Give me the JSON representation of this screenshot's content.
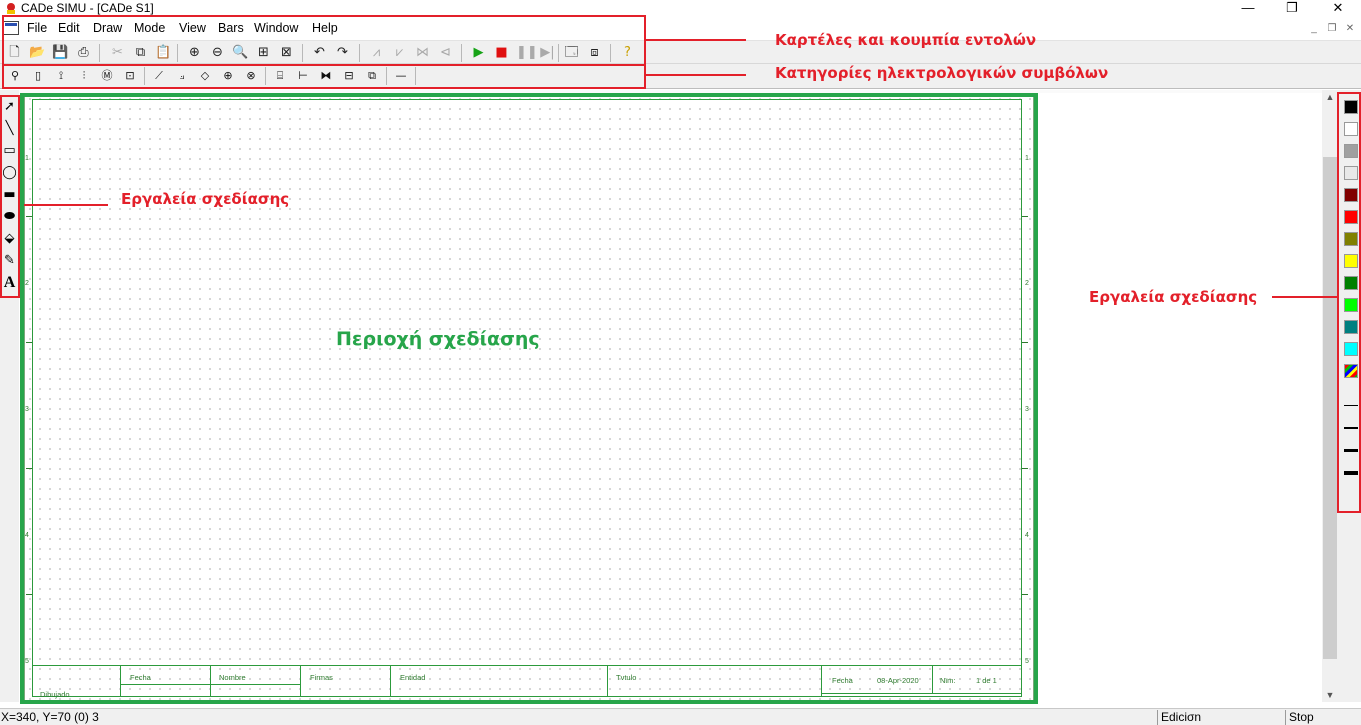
{
  "window": {
    "title": "CADe SIMU - [CADe S1]",
    "minimize": "—",
    "maximize": "❐",
    "close": "✕"
  },
  "menu": {
    "items": [
      "File",
      "Edit",
      "Draw",
      "Mode",
      "View",
      "Bars",
      "Window",
      "Help"
    ],
    "mdi_min": "_",
    "mdi_restore": "❐",
    "mdi_close": "✕"
  },
  "toolbar1": {
    "icons": [
      {
        "name": "new-file-icon",
        "glyph": "🗋",
        "enabled": true
      },
      {
        "name": "open-folder-icon",
        "glyph": "📂",
        "enabled": true
      },
      {
        "name": "save-icon",
        "glyph": "💾",
        "enabled": true
      },
      {
        "name": "print-icon",
        "glyph": "⎙",
        "enabled": true
      },
      {
        "name": "cut-icon",
        "glyph": "✂",
        "enabled": false
      },
      {
        "name": "copy-icon",
        "glyph": "⧉",
        "enabled": true
      },
      {
        "name": "paste-icon",
        "glyph": "📋",
        "enabled": true
      },
      {
        "name": "zoom-in-icon",
        "glyph": "⊕",
        "enabled": true
      },
      {
        "name": "zoom-out-icon",
        "glyph": "⊖",
        "enabled": true
      },
      {
        "name": "zoom-window-icon",
        "glyph": "🔍",
        "enabled": true
      },
      {
        "name": "zoom-all-icon",
        "glyph": "⊞",
        "enabled": true
      },
      {
        "name": "zoom-previous-icon",
        "glyph": "⊠",
        "enabled": true
      },
      {
        "name": "undo-icon",
        "glyph": "↶",
        "enabled": true
      },
      {
        "name": "redo-icon",
        "glyph": "↷",
        "enabled": true
      },
      {
        "name": "flip-horizontal-icon",
        "glyph": "⩘",
        "enabled": false
      },
      {
        "name": "flip-vertical-icon",
        "glyph": "⩗",
        "enabled": false
      },
      {
        "name": "mirror-icon",
        "glyph": "⋈",
        "enabled": false
      },
      {
        "name": "rotate-icon",
        "glyph": "⊲",
        "enabled": false
      },
      {
        "name": "play-icon",
        "glyph": "▶",
        "enabled": true,
        "color": "#16a316"
      },
      {
        "name": "stop-icon",
        "glyph": "■",
        "enabled": true,
        "color": "#e01010"
      },
      {
        "name": "pause-icon",
        "glyph": "❚❚",
        "enabled": false
      },
      {
        "name": "step-icon",
        "glyph": "▶|",
        "enabled": false
      },
      {
        "name": "window-view-icon",
        "glyph": "🗔",
        "enabled": true
      },
      {
        "name": "window-tile-icon",
        "glyph": "⧈",
        "enabled": true
      },
      {
        "name": "help-icon",
        "glyph": "?",
        "enabled": true,
        "color": "#c9a000"
      }
    ]
  },
  "toolbar2": {
    "icons": [
      {
        "name": "power-supply-icon",
        "glyph": "⚲"
      },
      {
        "name": "fuse-icon",
        "glyph": "▯"
      },
      {
        "name": "disconnector-icon",
        "glyph": "⟟"
      },
      {
        "name": "three-phase-switch-icon",
        "glyph": "⫶"
      },
      {
        "name": "motor-icon",
        "glyph": "Ⓜ"
      },
      {
        "name": "device-icon",
        "glyph": "⊡"
      },
      {
        "name": "contact-no-icon",
        "glyph": "⟋"
      },
      {
        "name": "contact-nc-icon",
        "glyph": "⟓"
      },
      {
        "name": "connector-icon",
        "glyph": "◇"
      },
      {
        "name": "coil-icon",
        "glyph": "⊕"
      },
      {
        "name": "lamp-icon",
        "glyph": "⊗"
      },
      {
        "name": "plc-icon",
        "glyph": "⌸"
      },
      {
        "name": "pneumatic-cylinder-icon",
        "glyph": "⊢"
      },
      {
        "name": "valve-icon",
        "glyph": "⧓"
      },
      {
        "name": "terminal-box-icon",
        "glyph": "⊟"
      },
      {
        "name": "wire-bus-icon",
        "glyph": "⧉"
      },
      {
        "name": "line-icon",
        "glyph": "—"
      }
    ]
  },
  "lefttools": [
    {
      "name": "select-arrow-icon",
      "glyph": "➚"
    },
    {
      "name": "line-tool-icon",
      "glyph": "╲"
    },
    {
      "name": "rectangle-tool-icon",
      "glyph": "▭"
    },
    {
      "name": "ellipse-tool-icon",
      "glyph": "◯"
    },
    {
      "name": "filled-rectangle-tool-icon",
      "glyph": "▬"
    },
    {
      "name": "filled-ellipse-tool-icon",
      "glyph": "⬬"
    },
    {
      "name": "fill-bucket-icon",
      "glyph": "⬙"
    },
    {
      "name": "eyedropper-icon",
      "glyph": "✎"
    },
    {
      "name": "text-tool-icon",
      "glyph": "A"
    }
  ],
  "palette": {
    "colors": [
      "#000000",
      "#ffffff",
      "#a0a0a0",
      "#e8e8e8",
      "#800000",
      "#ff0000",
      "#808000",
      "#ffff00",
      "#008000",
      "#00ff00",
      "#008080",
      "#00ffff"
    ],
    "line_widths": [
      1,
      2,
      3,
      4
    ]
  },
  "sheet": {
    "row_numbers": [
      "1",
      "2",
      "3",
      "4",
      "5"
    ],
    "titleblock": {
      "fecha": "Fecha",
      "nombre": "Nombre",
      "firmas": "Firmas",
      "entidad": "Entidad",
      "titulo": "Tνtulo",
      "dibujado": "Dibujado",
      "fecha2": "Fecha",
      "date": "08-Apr-2020",
      "num": "Nϊm:",
      "page": "1 de 1"
    }
  },
  "statusbar": {
    "coords": "X=340, Y=70 (0) 3",
    "mode": "Ediciσn",
    "state": "Stop"
  },
  "annotations": {
    "toolbar": "Καρτέλες και κουμπία εντολών",
    "symbols": "Κατηγορίες ηλεκτρολογικών συμβόλων",
    "left_tools": "Εργαλεία σχεδίασης",
    "right_tools": "Εργαλεία σχεδίασης",
    "drawing_area": "Περιοχή σχεδίασης"
  }
}
